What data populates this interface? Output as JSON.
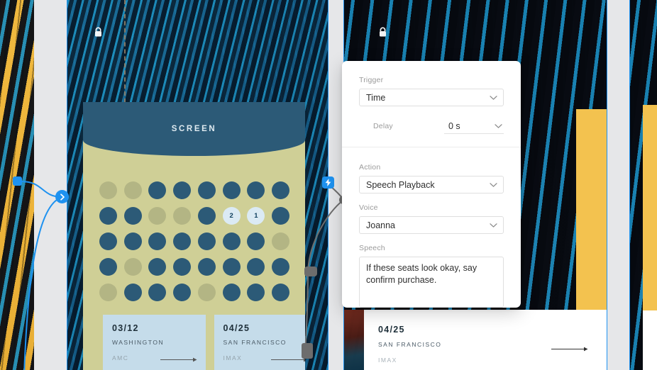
{
  "panel": {
    "trigger": {
      "label": "Trigger",
      "value": "Time"
    },
    "delay": {
      "label": "Delay",
      "value": "0 s"
    },
    "action": {
      "label": "Action",
      "value": "Speech Playback"
    },
    "voice": {
      "label": "Voice",
      "value": "Joanna"
    },
    "speech": {
      "label": "Speech",
      "value": "If these seats look okay, say confirm purchase."
    },
    "chevron_icon": "chevron-down-icon"
  },
  "frame1": {
    "screen_label": "SCREEN",
    "lock_icon": "lock-icon",
    "seat_legend": {
      "available": "#2c5a77",
      "taken": "#b3b584",
      "selected": "#dbeaf4"
    },
    "seat_rows": [
      [
        "taken",
        "taken",
        "available",
        "available",
        "available",
        "available",
        "available",
        "available"
      ],
      [
        "available",
        "available",
        "taken",
        "taken",
        "available",
        "selected",
        "selected",
        "available"
      ],
      [
        "available",
        "available",
        "available",
        "available",
        "available",
        "available",
        "available",
        "taken"
      ],
      [
        "available",
        "taken",
        "available",
        "available",
        "available",
        "available",
        "available",
        "available"
      ],
      [
        "taken",
        "available",
        "available",
        "available",
        "taken",
        "available",
        "available",
        "available"
      ]
    ],
    "seat_labels": {
      "r1c5": "2",
      "r1c6": "1"
    },
    "tickets": [
      {
        "date": "03/12",
        "city": "WASHINGTON",
        "format": "AMC",
        "arrow_icon": "arrow-right-icon"
      },
      {
        "date": "04/25",
        "city": "SAN FRANCISCO",
        "format": "IMAX",
        "arrow_icon": "arrow-right-icon"
      }
    ]
  },
  "frame2": {
    "lock_icon": "lock-icon",
    "ticket": {
      "date": "04/25",
      "city": "SAN FRANCISCO",
      "format": "IMAX",
      "arrow_icon": "arrow-right-icon"
    }
  },
  "prototype": {
    "start_handle_icon": "connector-handle",
    "flow_arrow_icon": "chevron-right-icon",
    "interaction_badge_icon": "lightning-bolt-icon"
  },
  "colors": {
    "accent": "#1e92f0",
    "seat_available": "#2c5a77",
    "seat_taken": "#b3b584",
    "seat_selected": "#dbeaf4",
    "card_bg": "#cfcf96",
    "ticket_bg": "#c5dcea",
    "canvas": "#e6e7e9"
  }
}
